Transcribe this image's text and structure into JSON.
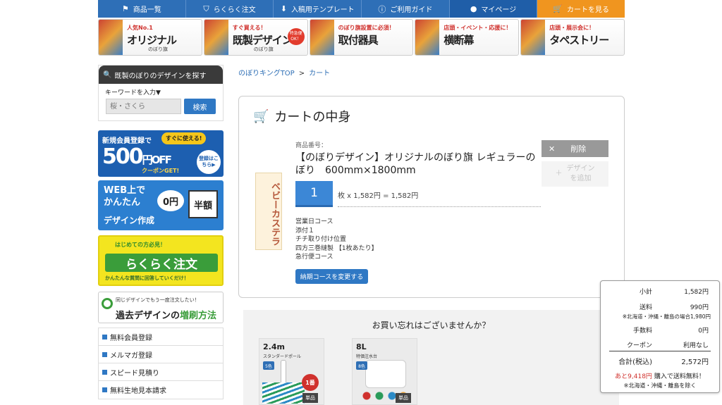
{
  "nav": [
    {
      "label": "商品一覧",
      "icon": "flag-icon"
    },
    {
      "label": "らくらく注文",
      "icon": "shield-icon"
    },
    {
      "label": "入稿用テンプレート",
      "icon": "download-icon"
    },
    {
      "label": "ご利用ガイド",
      "icon": "info-icon"
    },
    {
      "label": "マイページ",
      "icon": "user-icon"
    },
    {
      "label": "カートを見る",
      "icon": "cart-icon"
    }
  ],
  "banners": [
    {
      "sub": "人気No.1",
      "title": "オリジナル",
      "small": "のぼり旗"
    },
    {
      "sub": "すぐ買える！",
      "title": "既製デザイン",
      "small": "のぼり旗",
      "badge": "特急便OK！"
    },
    {
      "sub": "のぼり旗設置に必須！",
      "title": "取付器具",
      "small": ""
    },
    {
      "sub": "店頭・イベント・応援に！",
      "title": "横断幕",
      "small": ""
    },
    {
      "sub": "店頭・展示会に！",
      "title": "タペストリー",
      "small": ""
    }
  ],
  "sidebar": {
    "search_title": "既製のぼりのデザインを探す",
    "keyword_label": "キーワードを入力▼",
    "keyword_placeholder": "桜・さくら",
    "search_button": "検索",
    "promo1": {
      "line1": "新規会員登録で",
      "pill": "すぐに使える!",
      "big": "500",
      "unit": "円OFF",
      "coupon": "クーポンGET!",
      "circle": "登録はこちら▶"
    },
    "promo2": {
      "line1": "WEB上で",
      "line2": "かんたん",
      "line3": "デザイン作成",
      "fee": "0円",
      "half": "半額"
    },
    "promo3": {
      "top": "はじめての方必見！",
      "main": "らくらく注文",
      "sub": "かんたんな質問に回答していくだけ！"
    },
    "promo4": {
      "top": "同じデザインでもう一度注文したい！",
      "main_a": "過去デザインの",
      "main_b": "増刷方法"
    },
    "links": [
      "無料会員登録",
      "メルマガ登録",
      "スピード見積り",
      "無料生地見本請求"
    ]
  },
  "breadcrumb": {
    "home": "のぼりキングTOP",
    "sep": ">",
    "current": "カート"
  },
  "cart": {
    "title": "カートの中身",
    "flag_text": "ベビーカステラ",
    "product_no_label": "商品番号：",
    "product_name": "【のぼりデザイン】オリジナルのぼり旗 レギュラーのぼり　600mm×1800mm",
    "quantity": "1",
    "unit_line": "枚 x 1,582円 = 1,582円",
    "options": [
      "営業日コース",
      "添付１",
      "チチ取り付け位置",
      "四方三巻縫製 【1枚あたり】",
      "急行便コース"
    ],
    "change_button": "納期コースを変更する",
    "delete_button": "削除",
    "design_button_line1": "デザイン",
    "design_button_line2": "を追加"
  },
  "recommend": {
    "heading": "お買い忘れはございませんか？",
    "products": [
      {
        "name": "2.4m",
        "sub": "スタンダードポール",
        "badge": "5色",
        "rank": "1番",
        "tag": "単品"
      },
      {
        "name": "8L",
        "sub": "特価注水台",
        "badge": "8色",
        "tag": "単品"
      }
    ]
  },
  "summary": {
    "rows": [
      {
        "k": "小計",
        "v": "1,582円"
      },
      {
        "k": "送料",
        "v": "990円"
      },
      {
        "k": "手数料",
        "v": "0円"
      },
      {
        "k": "クーポン",
        "v": "利用なし"
      }
    ],
    "shipping_note": "※北海道・沖縄・離島の場合1,980円",
    "total_label": "合計(税込)",
    "total_value": "2,572円",
    "free_amount": "あと9,418円",
    "free_text": "購入で送料無料！",
    "free_note": "※北海道・沖縄・離島を除く"
  }
}
